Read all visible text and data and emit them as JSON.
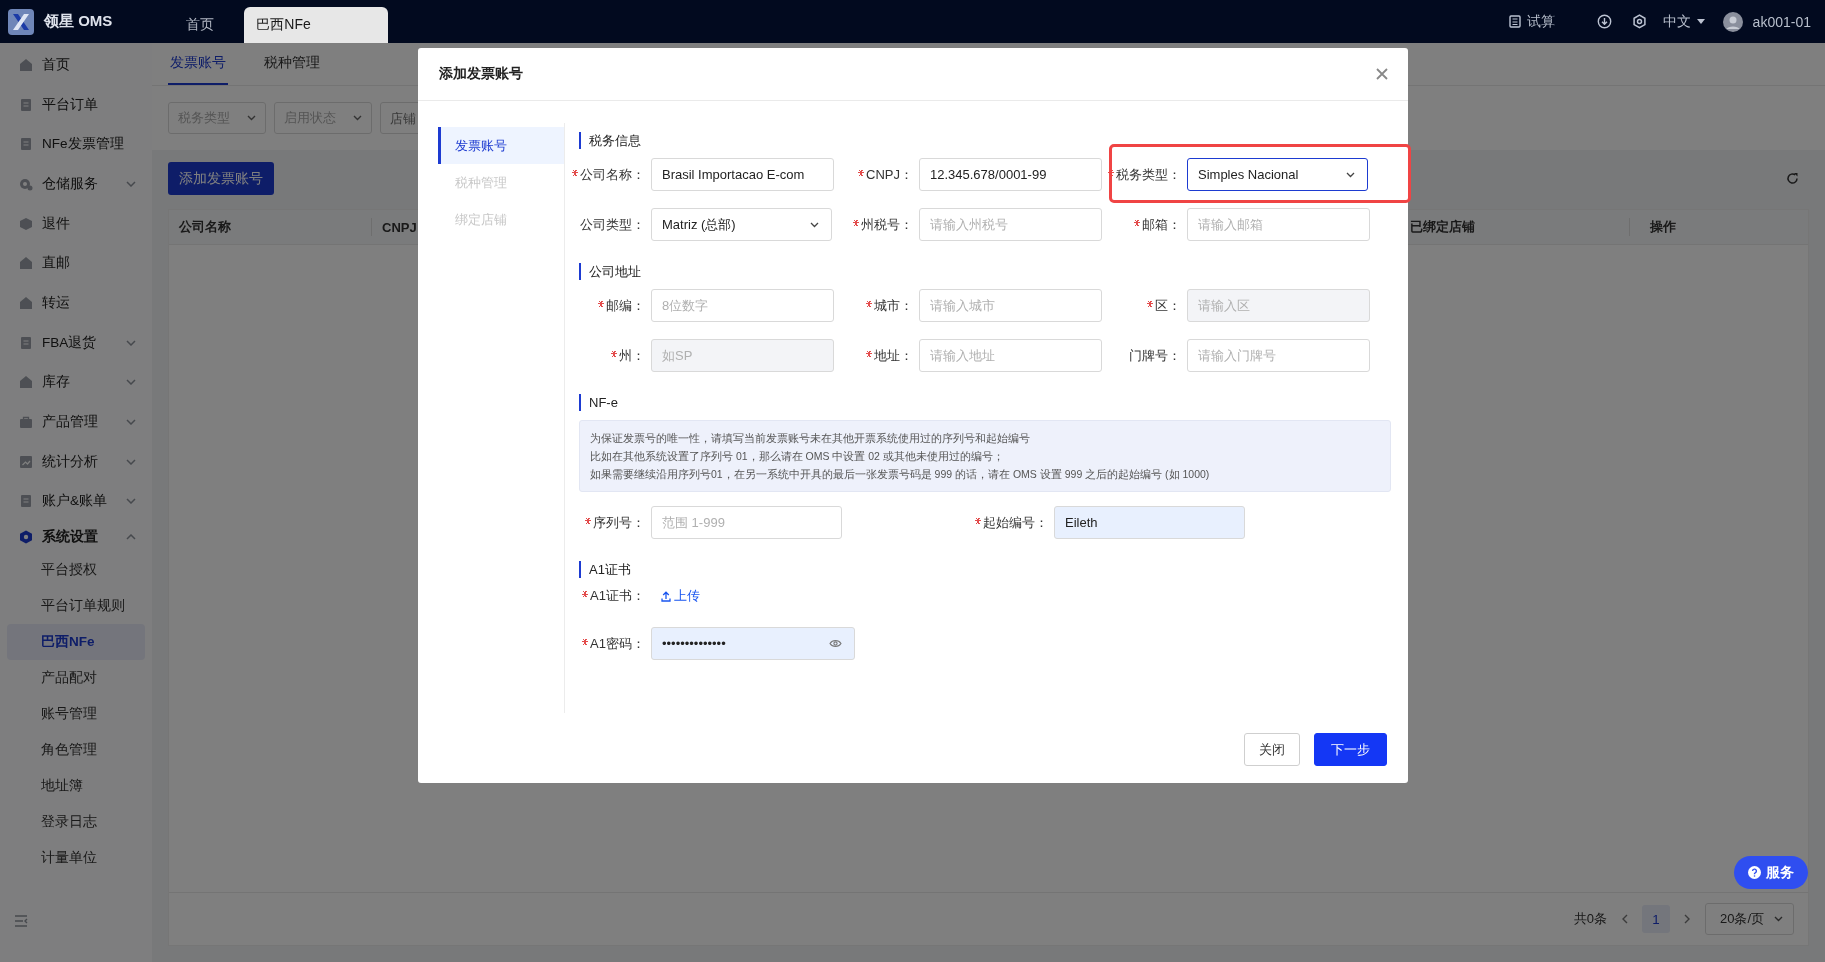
{
  "top_bar": {
    "logo_text": "领星 OMS",
    "tabs": [
      {
        "label": "首页",
        "selected": false
      },
      {
        "label": "巴西NFe",
        "selected": true
      }
    ],
    "calc_label": "试算",
    "language": "中文",
    "user": "ak001-01"
  },
  "sidebar": {
    "items": [
      {
        "label": "首页",
        "kind": "link",
        "selected": false
      },
      {
        "label": "平台订单",
        "kind": "link",
        "selected": false
      },
      {
        "label": "NFe发票管理",
        "kind": "link",
        "selected": false
      },
      {
        "label": "仓储服务",
        "kind": "group",
        "expanded": false,
        "selected": false
      },
      {
        "label": "退件",
        "kind": "link",
        "selected": false
      },
      {
        "label": "直邮",
        "kind": "link",
        "selected": false
      },
      {
        "label": "转运",
        "kind": "link",
        "selected": false
      },
      {
        "label": "FBA退货",
        "kind": "group",
        "expanded": false,
        "selected": false
      },
      {
        "label": "库存",
        "kind": "group",
        "expanded": false,
        "selected": false
      },
      {
        "label": "产品管理",
        "kind": "group",
        "expanded": false,
        "selected": false
      },
      {
        "label": "统计分析",
        "kind": "group",
        "expanded": false,
        "selected": false
      },
      {
        "label": "账户&账单",
        "kind": "group",
        "expanded": false,
        "selected": false
      },
      {
        "label": "系统设置",
        "kind": "group",
        "expanded": true,
        "selected": true,
        "children": [
          {
            "label": "平台授权",
            "selected": false
          },
          {
            "label": "平台订单规则",
            "selected": false
          },
          {
            "label": "巴西NFe",
            "selected": true
          },
          {
            "label": "产品配对",
            "selected": false
          },
          {
            "label": "账号管理",
            "selected": false
          },
          {
            "label": "角色管理",
            "selected": false
          },
          {
            "label": "地址簿",
            "selected": false
          },
          {
            "label": "登录日志",
            "selected": false
          },
          {
            "label": "计量单位",
            "selected": false
          }
        ]
      }
    ]
  },
  "page": {
    "tabs": [
      {
        "label": "发票账号",
        "selected": true
      },
      {
        "label": "税种管理",
        "selected": false
      }
    ],
    "filters": [
      {
        "placeholder": "税务类型",
        "kind": "select"
      },
      {
        "placeholder": "启用状态",
        "kind": "select"
      },
      {
        "placeholder": "店铺",
        "kind": "input"
      }
    ],
    "add_button": "添加发票账号",
    "table": {
      "columns": [
        "公司名称",
        "CNPJ",
        "已绑定店铺",
        "操作"
      ]
    },
    "pagination": {
      "total": "共0条",
      "pages": [
        {
          "label": "1",
          "selected": true
        }
      ],
      "page_size": "20条/页"
    },
    "service_button": "服务"
  },
  "dialog": {
    "title": "添加发票账号",
    "nav": [
      {
        "label": "发票账号",
        "selected": true,
        "disabled": false
      },
      {
        "label": "税种管理",
        "selected": false,
        "disabled": true
      },
      {
        "label": "绑定店铺",
        "selected": false,
        "disabled": true
      }
    ],
    "sections": [
      {
        "title": "税务信息",
        "kind": "standard",
        "fields": [
          {
            "label": "公司名称：",
            "required": true,
            "kind": "input",
            "value": "Brasil Importacao E-com"
          },
          {
            "label": "CNPJ：",
            "required": true,
            "kind": "input",
            "value": "12.345.678/0001-99"
          },
          {
            "label": "税务类型：",
            "required": true,
            "kind": "select",
            "value": "Simples Nacional",
            "focused": true,
            "highlighted": true
          },
          {
            "label": "公司类型：",
            "required": false,
            "kind": "select",
            "value": "Matriz (总部)"
          },
          {
            "label": "州税号：",
            "required": true,
            "kind": "input",
            "placeholder": "请输入州税号"
          },
          {
            "label": "邮箱：",
            "required": true,
            "kind": "input",
            "placeholder": "请输入邮箱"
          }
        ]
      },
      {
        "title": "公司地址",
        "kind": "standard",
        "fields": [
          {
            "label": "邮编：",
            "required": true,
            "kind": "input",
            "placeholder": "8位数字"
          },
          {
            "label": "城市：",
            "required": true,
            "kind": "input",
            "placeholder": "请输入城市"
          },
          {
            "label": "区：",
            "required": true,
            "kind": "input",
            "placeholder": "请输入区",
            "disabled": true
          },
          {
            "label": "州：",
            "required": true,
            "kind": "input",
            "placeholder": "如SP",
            "disabled": true
          },
          {
            "label": "地址：",
            "required": true,
            "kind": "input",
            "placeholder": "请输入地址"
          },
          {
            "label": "门牌号：",
            "required": false,
            "kind": "input",
            "placeholder": "请输入门牌号"
          }
        ]
      },
      {
        "title": "NF-e",
        "kind": "nfe",
        "notice": [
          "为保证发票号的唯一性，请填写当前发票账号未在其他开票系统使用过的序列号和起始编号",
          "比如在其他系统设置了序列号 01，那么请在 OMS 中设置 02 或其他未使用过的编号；",
          "如果需要继续沿用序列号01，在另一系统中开具的最后一张发票号码是 999 的话，请在 OMS 设置 999 之后的起始编号 (如 1000)"
        ],
        "fields": [
          {
            "label": "序列号：",
            "required": true,
            "kind": "input",
            "placeholder": "范围 1-999"
          },
          {
            "label": "起始编号：",
            "required": true,
            "kind": "input",
            "value": "Eileth",
            "autofilled": true
          }
        ]
      },
      {
        "title": "A1证书",
        "kind": "certificate",
        "fields": [
          {
            "label": "A1证书：",
            "required": true,
            "kind": "upload",
            "link": "上传"
          },
          {
            "label": "A1密码：",
            "required": true,
            "kind": "password",
            "value": "••••••••••••••",
            "autofilled": true
          }
        ]
      }
    ],
    "buttons": [
      {
        "label": "关闭",
        "kind": "default"
      },
      {
        "label": "下一步",
        "kind": "primary"
      }
    ]
  }
}
